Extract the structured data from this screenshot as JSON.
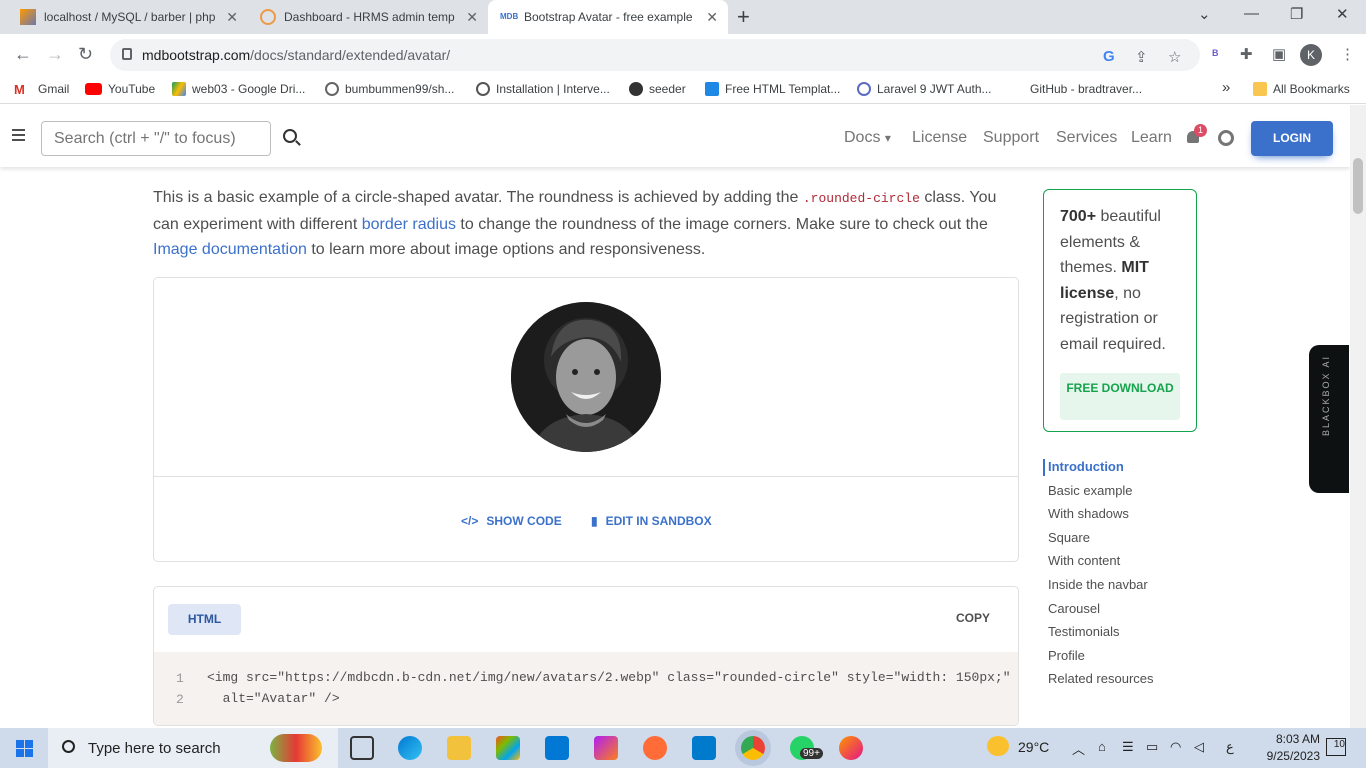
{
  "browser": {
    "tabs": [
      {
        "title": "localhost / MySQL / barber | php",
        "icon": "phpmyadmin-icon"
      },
      {
        "title": "Dashboard - HRMS admin temp",
        "icon": "hrms-icon"
      },
      {
        "title": "Bootstrap Avatar - free example",
        "icon": "mdb-icon",
        "active": true
      }
    ],
    "url_host": "mdbootstrap.com",
    "url_path": "/docs/standard/extended/avatar/",
    "profile_initial": "K",
    "extension_label": "B",
    "bookmarks": [
      "Gmail",
      "YouTube",
      "web03 - Google Dri...",
      "bumbummen99/sh...",
      "Installation | Interve...",
      "seeder",
      "Free HTML Templat...",
      "Laravel 9 JWT Auth...",
      "GitHub - bradtraver..."
    ],
    "all_bookmarks": "All Bookmarks",
    "overflow": "»"
  },
  "site": {
    "search_placeholder": "Search (ctrl + \"/\" to focus)",
    "nav": [
      "Docs",
      "License",
      "Support",
      "Services",
      "Learn"
    ],
    "docs_caret": "▾",
    "notification_count": "1",
    "login": "LOGIN"
  },
  "content": {
    "intro_1": "This is a basic example of a circle-shaped avatar. The roundness is achieved by adding the ",
    "intro_code": ".rounded-circle",
    "intro_2": " class. You can experiment with different ",
    "intro_link1": "border radius",
    "intro_3": " to change the roundness of the image corners. Make sure to check out the ",
    "intro_link2": "Image documentation",
    "intro_4": " to learn more about image options and responsiveness.",
    "show_code": "SHOW CODE",
    "edit_sandbox": "EDIT IN SANDBOX",
    "code_tab": "HTML",
    "copy": "COPY",
    "code_lines": [
      {
        "num": "1",
        "text": "<img src=\"https://mdbcdn.b-cdn.net/img/new/avatars/2.webp\" class=\"rounded-circle\" style=\"width: 150px;\""
      },
      {
        "num": "2",
        "text": "  alt=\"Avatar\" />"
      }
    ]
  },
  "promo": {
    "bold1": "700+",
    "text1": " beautiful elements & themes. ",
    "bold2": "MIT license",
    "text2": ", no registration or email required.",
    "button": "FREE DOWNLOAD"
  },
  "toc": [
    "Introduction",
    "Basic example",
    "With shadows",
    "Square",
    "With content",
    "Inside the navbar",
    "Carousel",
    "Testimonials",
    "Profile",
    "Related resources"
  ],
  "blackbox_label": "BLACKBOX AI",
  "taskbar": {
    "search_placeholder": "Type here to search",
    "weather": "29°C",
    "time": "8:03 AM",
    "date": "9/25/2023",
    "whatsapp_badge": "99+",
    "notifications": "10",
    "lang": "ع"
  },
  "colors": {
    "accent": "#3b71ca",
    "success": "#14a44d",
    "danger": "#dc4c64"
  }
}
